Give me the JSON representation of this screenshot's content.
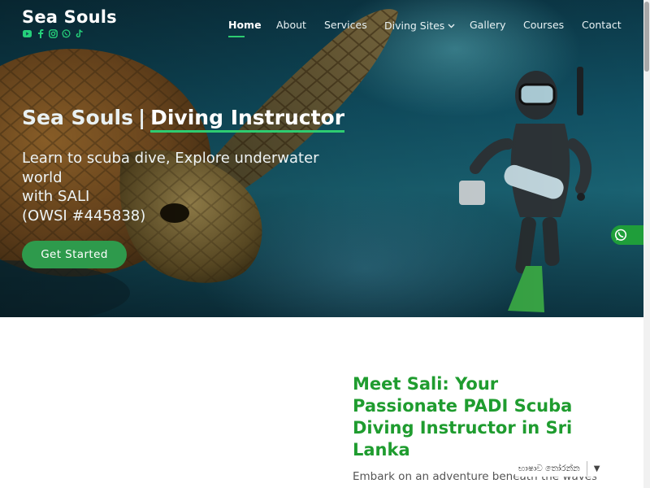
{
  "brand": {
    "name": "Sea Souls"
  },
  "socials": [
    {
      "icon": "youtube-icon"
    },
    {
      "icon": "facebook-icon"
    },
    {
      "icon": "instagram-icon"
    },
    {
      "icon": "whatsapp-icon"
    },
    {
      "icon": "tiktok-icon"
    }
  ],
  "nav": {
    "items": [
      {
        "label": "Home",
        "active": true
      },
      {
        "label": "About"
      },
      {
        "label": "Services"
      },
      {
        "label": "Diving Sites",
        "has_dropdown": true
      },
      {
        "label": "Gallery"
      },
      {
        "label": "Courses"
      },
      {
        "label": "Contact"
      }
    ]
  },
  "hero": {
    "title_prefix": "Sea Souls",
    "title_separator": "|",
    "title_highlight": "Diving Instructor",
    "subtitle_lines": [
      "Learn to scuba dive, Explore underwater",
      "world",
      "with SALI",
      "(OWSI #445838)"
    ],
    "cta_label": "Get Started"
  },
  "whatsapp_float": {
    "icon": "whatsapp-icon"
  },
  "about": {
    "title": "Meet Sali: Your Passionate PADI Scuba Diving Instructor in Sri Lanka",
    "body": "Embark on an adventure beneath the waves with"
  },
  "translate_widget": {
    "label": "භාෂාව තෝරන්න",
    "arrow": "▼"
  },
  "colors": {
    "accent_green": "#2ecc71",
    "button_green": "#2e9a4c",
    "heading_green": "#1f9c2f",
    "whatsapp_green": "#1f9e3a"
  }
}
